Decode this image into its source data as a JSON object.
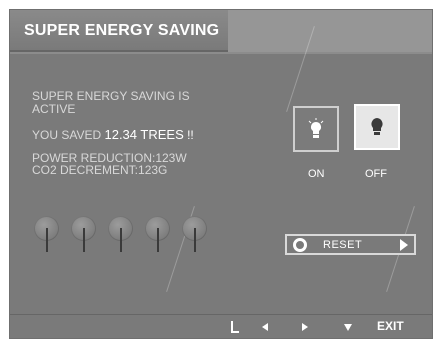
{
  "header": {
    "title": "SUPER ENERGY SAVING"
  },
  "status": {
    "active_line1": "SUPER ENERGY SAVING IS",
    "active_line2": "ACTIVE",
    "saved_prefix": "YOU SAVED",
    "saved_value": "12.34 TREES",
    "saved_suffix": "!!",
    "power_reduction": "POWER REDUCTION:123W",
    "co2_decrement": "CO2 DECREMENT:123G"
  },
  "mode": {
    "on_label": "ON",
    "off_label": "OFF",
    "selected": "OFF"
  },
  "reset": {
    "label": "RESET"
  },
  "trees": {
    "count": 5,
    "icon": "tree-icon"
  },
  "footer": {
    "exit_label": "EXIT",
    "icons": [
      "enter-icon",
      "left-arrow-icon",
      "right-arrow-icon",
      "down-arrow-icon"
    ]
  },
  "colors": {
    "panel": "#7a7a7a",
    "title_bar": "#8a8a8a",
    "text_muted": "#d8d8d8",
    "text_white": "#ffffff",
    "off_button": "#e7e7e7"
  }
}
